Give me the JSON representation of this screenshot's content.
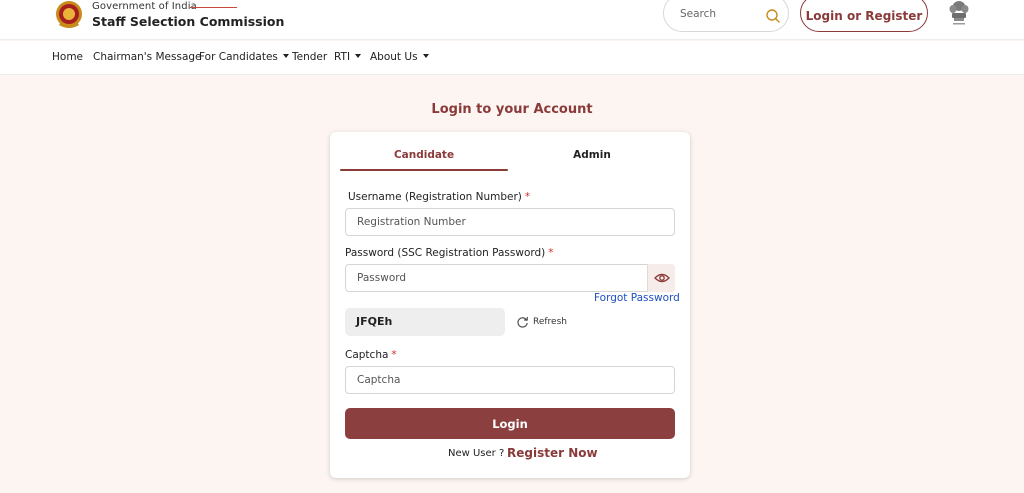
{
  "header": {
    "gov_text": "Government of India",
    "org_name": "Staff Selection Commission",
    "search_placeholder": "Search",
    "login_register_label": "Login or Register"
  },
  "nav": {
    "items": [
      {
        "label": "Home",
        "has_dropdown": false
      },
      {
        "label": "Chairman's Message",
        "has_dropdown": false
      },
      {
        "label": "For Candidates",
        "has_dropdown": true
      },
      {
        "label": "Tender",
        "has_dropdown": false
      },
      {
        "label": "RTI",
        "has_dropdown": true
      },
      {
        "label": "About Us",
        "has_dropdown": true
      }
    ]
  },
  "login": {
    "title": "Login to your Account",
    "tabs": [
      {
        "label": "Candidate",
        "active": true
      },
      {
        "label": "Admin",
        "active": false
      }
    ],
    "username_label": "Username (Registration Number)",
    "username_placeholder": "Registration Number",
    "password_label": "Password (SSC Registration Password)",
    "password_placeholder": "Password",
    "required_mark": "*",
    "forgot_password": "Forgot Password",
    "captcha_text": "JFQEh",
    "refresh_label": "Refresh",
    "captcha_label": "Captcha",
    "captcha_placeholder": "Captcha",
    "login_button": "Login",
    "new_user_text": "New User ?",
    "register_now": "Register Now"
  },
  "colors": {
    "brand": "#8b3a3a",
    "link": "#1e4fc4",
    "required": "#d0322a",
    "page_bg": "#fdf5f1"
  },
  "icons": [
    "ssc-emblem-icon",
    "search-icon",
    "national-emblem-icon",
    "caret-down-icon",
    "eye-icon",
    "refresh-icon"
  ]
}
